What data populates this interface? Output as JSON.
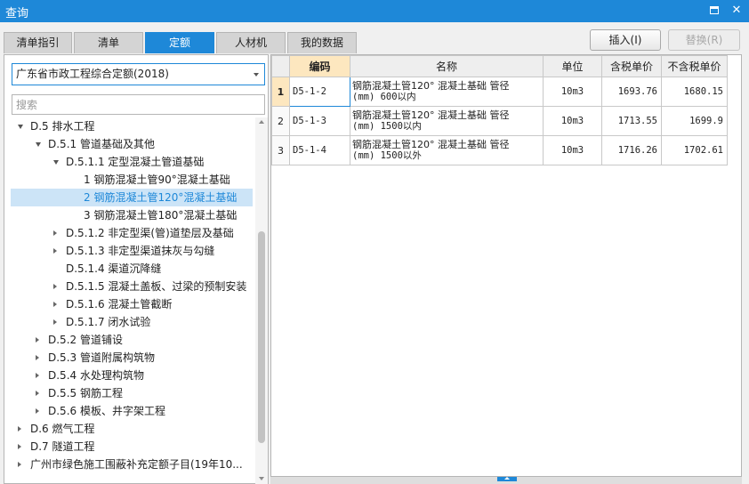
{
  "window": {
    "title": "查询",
    "restore_glyph": "",
    "close_glyph": "✕"
  },
  "tabs": [
    {
      "label": "清单指引"
    },
    {
      "label": "清单"
    },
    {
      "label": "定额",
      "active": true
    },
    {
      "label": "人材机"
    },
    {
      "label": "我的数据"
    }
  ],
  "toolbar": {
    "insert_label": "插入(I)",
    "replace_label": "替换(R)"
  },
  "library_select": {
    "value": "广东省市政工程综合定额(2018)"
  },
  "search": {
    "placeholder": "搜索"
  },
  "tree": [
    {
      "label": "D.5 排水工程",
      "level": 0,
      "state": "open"
    },
    {
      "label": "D.5.1 管道基础及其他",
      "level": 1,
      "state": "open"
    },
    {
      "label": "D.5.1.1 定型混凝土管道基础",
      "level": 2,
      "state": "open"
    },
    {
      "label": "1 钢筋混凝土管90°混凝土基础",
      "level": 3,
      "state": "leaf"
    },
    {
      "label": "2 钢筋混凝土管120°混凝土基础",
      "level": 3,
      "state": "leaf",
      "selected": true
    },
    {
      "label": "3 钢筋混凝土管180°混凝土基础",
      "level": 3,
      "state": "leaf"
    },
    {
      "label": "D.5.1.2 非定型渠(管)道垫层及基础",
      "level": 2,
      "state": "closed"
    },
    {
      "label": "D.5.1.3 非定型渠道抹灰与勾缝",
      "level": 2,
      "state": "closed"
    },
    {
      "label": "D.5.1.4 渠道沉降缝",
      "level": 2,
      "state": "leaf"
    },
    {
      "label": "D.5.1.5 混凝土盖板、过梁的预制安装",
      "level": 2,
      "state": "closed"
    },
    {
      "label": "D.5.1.6 混凝土管截断",
      "level": 2,
      "state": "closed"
    },
    {
      "label": "D.5.1.7 闭水试验",
      "level": 2,
      "state": "closed"
    },
    {
      "label": "D.5.2 管道铺设",
      "level": 1,
      "state": "closed"
    },
    {
      "label": "D.5.3 管道附属构筑物",
      "level": 1,
      "state": "closed"
    },
    {
      "label": "D.5.4 水处理构筑物",
      "level": 1,
      "state": "closed"
    },
    {
      "label": "D.5.5 钢筋工程",
      "level": 1,
      "state": "closed"
    },
    {
      "label": "D.5.6 模板、井字架工程",
      "level": 1,
      "state": "closed"
    },
    {
      "label": "D.6 燃气工程",
      "level": 0,
      "state": "closed"
    },
    {
      "label": "D.7 隧道工程",
      "level": 0,
      "state": "closed"
    },
    {
      "label": "广州市绿色施工围蔽补充定额子目(19年10...",
      "level": 0,
      "state": "closed"
    },
    {
      "label": "…",
      "level": 0,
      "state": "leaf"
    }
  ],
  "grid": {
    "columns": [
      "编码",
      "名称",
      "单位",
      "含税单价",
      "不含税单价"
    ],
    "rows": [
      {
        "no": "1",
        "code": "D5-1-2",
        "name_line1": "钢筋混凝土管120° 混凝土基础 管径",
        "name_line2": "(mm) 600以内",
        "unit": "10m3",
        "price_tax": "1693.76",
        "price_notax": "1680.15",
        "current": true
      },
      {
        "no": "2",
        "code": "D5-1-3",
        "name_line1": "钢筋混凝土管120° 混凝土基础 管径",
        "name_line2": "(mm) 1500以内",
        "unit": "10m3",
        "price_tax": "1713.55",
        "price_notax": "1699.9"
      },
      {
        "no": "3",
        "code": "D5-1-4",
        "name_line1": "钢筋混凝土管120° 混凝土基础 管径",
        "name_line2": "(mm) 1500以外",
        "unit": "10m3",
        "price_tax": "1716.26",
        "price_notax": "1702.61"
      }
    ]
  },
  "colors": {
    "accent": "#1e88d8",
    "header_highlight": "#fde7bf",
    "selection": "#cce4f7"
  }
}
